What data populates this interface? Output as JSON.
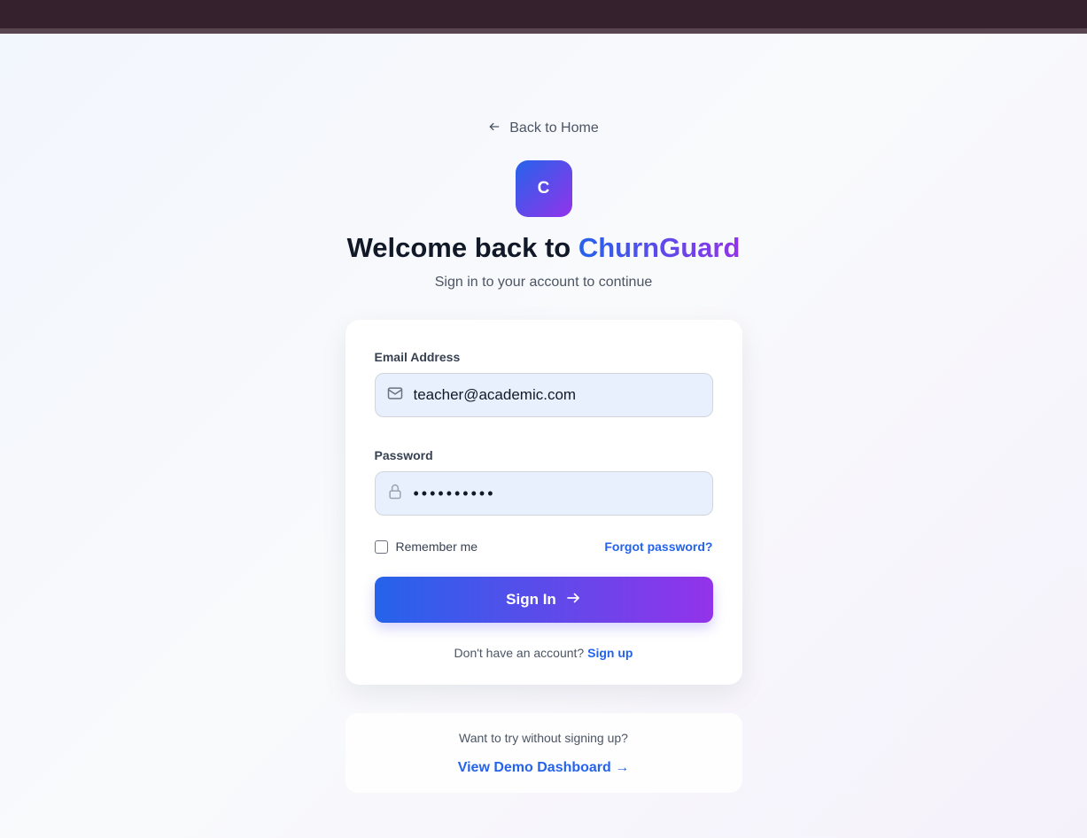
{
  "back_link": {
    "label": "Back to Home"
  },
  "logo": {
    "letter": "C"
  },
  "heading": {
    "prefix": "Welcome back to ",
    "brand": "ChurnGuard"
  },
  "subtitle": "Sign in to your account to continue",
  "form": {
    "email_label": "Email Address",
    "email_value": "teacher@academic.com",
    "password_label": "Password",
    "password_value": "••••••••••",
    "remember_label": "Remember me",
    "forgot_label": "Forgot password?",
    "signin_label": "Sign In",
    "no_account_text": "Don't have an account?",
    "signup_label": "Sign up"
  },
  "demo": {
    "prompt": "Want to try without signing up?",
    "link_label": "View Demo Dashboard",
    "link_arrow": "→"
  },
  "colors": {
    "brand_start": "#2563eb",
    "brand_end": "#9333ea",
    "link": "#2563eb",
    "top_bar": "#35202d"
  },
  "icons": {
    "back": "arrow-left-icon",
    "email": "mail-icon",
    "password": "lock-icon",
    "signin": "arrow-right-icon"
  }
}
